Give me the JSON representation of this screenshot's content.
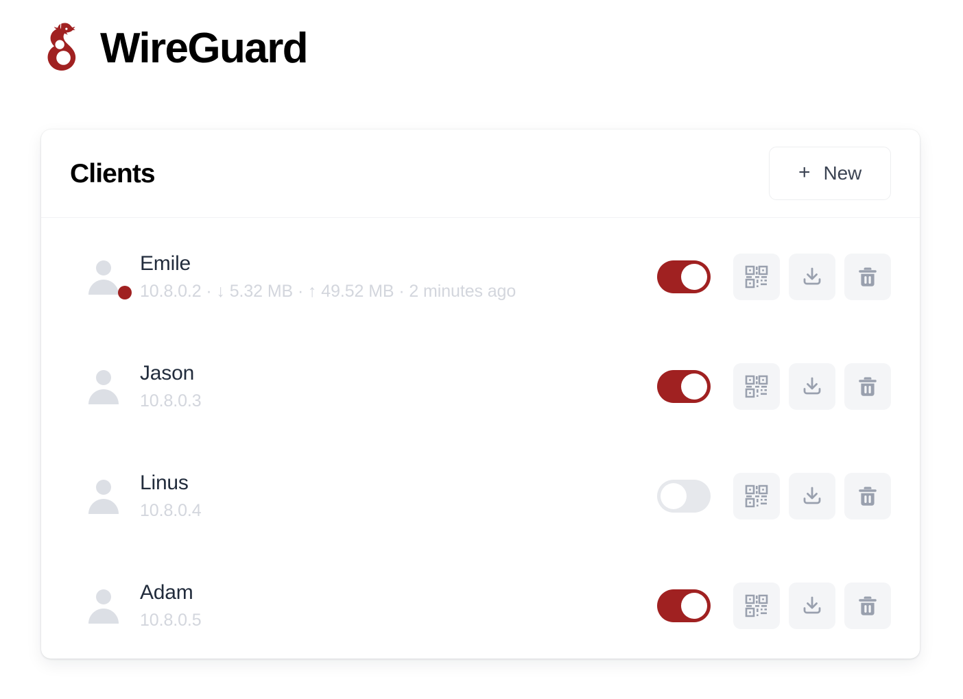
{
  "brand": {
    "title": "WireGuard",
    "logo_icon": "wireguard-dragon-logo",
    "logo_color": "#a02121"
  },
  "card": {
    "title": "Clients",
    "new_button": {
      "label": "New",
      "icon": "plus-icon"
    }
  },
  "colors": {
    "accent": "#a02121",
    "toggle_off": "#e6e8ec",
    "icon_button_bg": "#f4f5f7",
    "icon_glyph": "#99a0ae",
    "name_text": "#222c3c",
    "meta_text": "#d3d6dd",
    "card_bg": "#ffffff",
    "page_bg": "#ffffff"
  },
  "actions": {
    "qr_label": "qr-code-icon",
    "download_label": "download-icon",
    "delete_label": "trash-icon",
    "toggle_label": "enable-toggle"
  },
  "clients": [
    {
      "name": "Emile",
      "address": "10.8.0.2",
      "meta": "10.8.0.2 · ↓ 5.32 MB · ↑ 49.52 MB · 2 minutes ago",
      "transfer_rx": "5.32 MB",
      "transfer_tx": "49.52 MB",
      "last_seen": "2 minutes ago",
      "enabled": true,
      "online": true
    },
    {
      "name": "Jason",
      "address": "10.8.0.3",
      "meta": "10.8.0.3",
      "transfer_rx": "",
      "transfer_tx": "",
      "last_seen": "",
      "enabled": true,
      "online": false
    },
    {
      "name": "Linus",
      "address": "10.8.0.4",
      "meta": "10.8.0.4",
      "transfer_rx": "",
      "transfer_tx": "",
      "last_seen": "",
      "enabled": false,
      "online": false
    },
    {
      "name": "Adam",
      "address": "10.8.0.5",
      "meta": "10.8.0.5",
      "transfer_rx": "",
      "transfer_tx": "",
      "last_seen": "",
      "enabled": true,
      "online": false
    }
  ]
}
